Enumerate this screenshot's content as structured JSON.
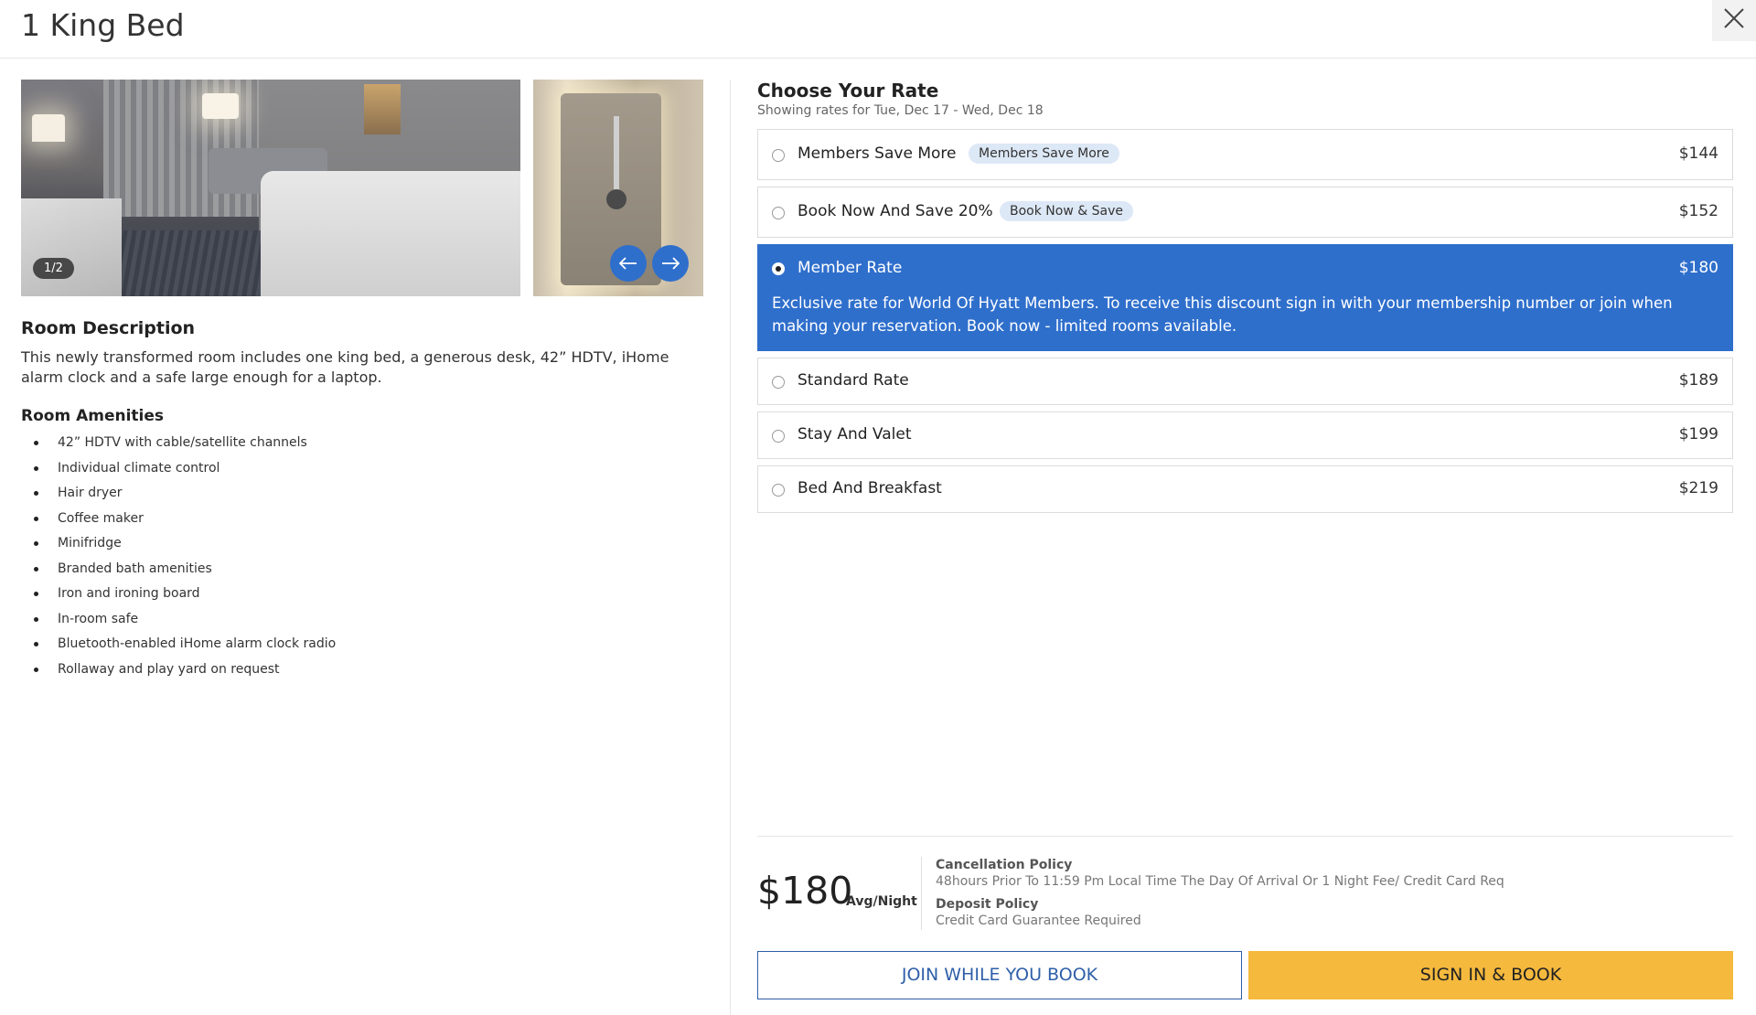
{
  "header": {
    "title": "1 King Bed",
    "close_icon": "close-icon"
  },
  "gallery": {
    "counter": "1/2",
    "prev_icon": "arrow-left-icon",
    "next_icon": "arrow-right-icon"
  },
  "room": {
    "description_title": "Room Description",
    "description": "This newly transformed room includes one king bed, a generous desk, 42” HDTV, iHome alarm clock and a safe large enough for a laptop.",
    "amenities_title": "Room Amenities",
    "amenities": [
      "42” HDTV with cable/satellite channels",
      "Individual climate control",
      "Hair dryer",
      "Coffee maker",
      "Minifridge",
      "Branded bath amenities",
      "Iron and ironing board",
      "In-room safe",
      "Bluetooth-enabled iHome alarm clock radio",
      "Rollaway and play yard on request"
    ]
  },
  "rates": {
    "title": "Choose Your Rate",
    "subtitle": "Showing rates for Tue, Dec 17 - Wed, Dec 18",
    "items": [
      {
        "name": "Members Save More",
        "badge": "Members Save More",
        "price": "$144"
      },
      {
        "name": "Book Now And Save 20%",
        "badge": "Book Now & Save",
        "price": "$152"
      },
      {
        "name": "Member Rate",
        "price": "$180",
        "selected": true,
        "description": "Exclusive rate for World Of Hyatt Members. To receive this discount sign in with your membership number or join when making your reservation. Book now - limited rooms available."
      },
      {
        "name": "Standard Rate",
        "price": "$189"
      },
      {
        "name": "Stay And Valet",
        "price": "$199"
      },
      {
        "name": "Bed And Breakfast",
        "price": "$219"
      }
    ]
  },
  "summary": {
    "amount": "$180",
    "unit": "Avg/Night",
    "cancellation_title": "Cancellation Policy",
    "cancellation_text": "48hours Prior To 11:59 Pm Local Time The Day Of Arrival Or 1 Night Fee/ Credit Card Req",
    "deposit_title": "Deposit Policy",
    "deposit_text": "Credit Card Guarantee Required"
  },
  "actions": {
    "join": "JOIN WHILE YOU BOOK",
    "sign_in": "SIGN IN & BOOK"
  },
  "colors": {
    "accent": "#2f6fcc",
    "badge_bg": "#dde8f6",
    "cta": "#f5b93d",
    "join_border": "#2f5fa8"
  }
}
